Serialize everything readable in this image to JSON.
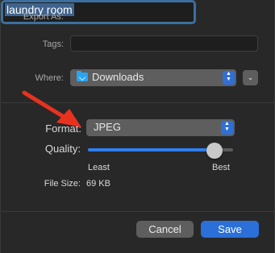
{
  "export_as": {
    "label": "Export As:",
    "value": "laundry room"
  },
  "tags": {
    "label": "Tags:",
    "value": ""
  },
  "where": {
    "label": "Where:",
    "value": "Downloads",
    "icon": "downloads-folder-icon"
  },
  "format": {
    "label": "Format:",
    "value": "JPEG"
  },
  "quality": {
    "label": "Quality:",
    "min_label": "Least",
    "max_label": "Best",
    "level": 0.87
  },
  "file_size": {
    "label": "File Size:",
    "value": "69 KB"
  },
  "buttons": {
    "cancel": "Cancel",
    "save": "Save"
  },
  "colors": {
    "accent": "#2b6fd8",
    "annotation_arrow": "#e8321f",
    "sheet_bg": "#282828"
  }
}
